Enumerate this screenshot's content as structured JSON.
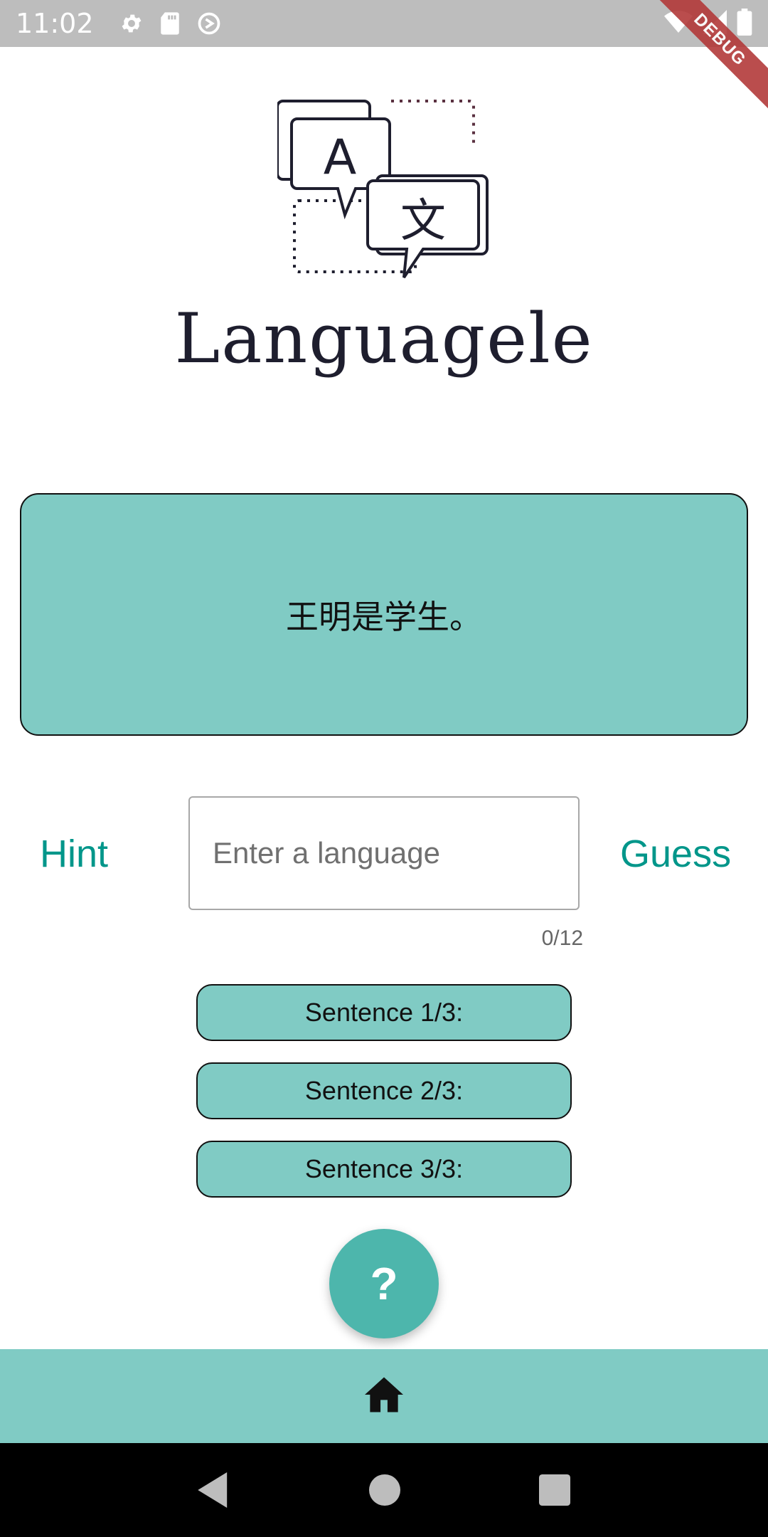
{
  "status_bar": {
    "time": "11:02",
    "icons_left": [
      "settings-icon",
      "sd-card-icon",
      "sync-icon"
    ],
    "icons_right": [
      "wifi-icon",
      "signal-icon",
      "battery-icon"
    ],
    "debug_label": "DEBUG"
  },
  "header": {
    "logo_letters": [
      "A",
      "文"
    ],
    "title": "Languagele"
  },
  "puzzle": {
    "sentence": "王明是学生。"
  },
  "input_row": {
    "hint_label": "Hint",
    "guess_label": "Guess",
    "placeholder": "Enter a language",
    "value": "",
    "counter": "0/12"
  },
  "sentences": [
    {
      "label": "Sentence 1/3:"
    },
    {
      "label": "Sentence 2/3:"
    },
    {
      "label": "Sentence 3/3:"
    }
  ],
  "fab": {
    "label": "?"
  },
  "bottom_bar": {
    "icon": "home-icon"
  },
  "nav_bar": {
    "icons": [
      "back-icon",
      "home-circle-icon",
      "recents-icon"
    ]
  },
  "colors": {
    "accent": "#80cbc4",
    "fab": "#4db6ac",
    "text_button": "#00968a",
    "status_bar": "#bdbdbd",
    "debug": "#b33a3a"
  }
}
